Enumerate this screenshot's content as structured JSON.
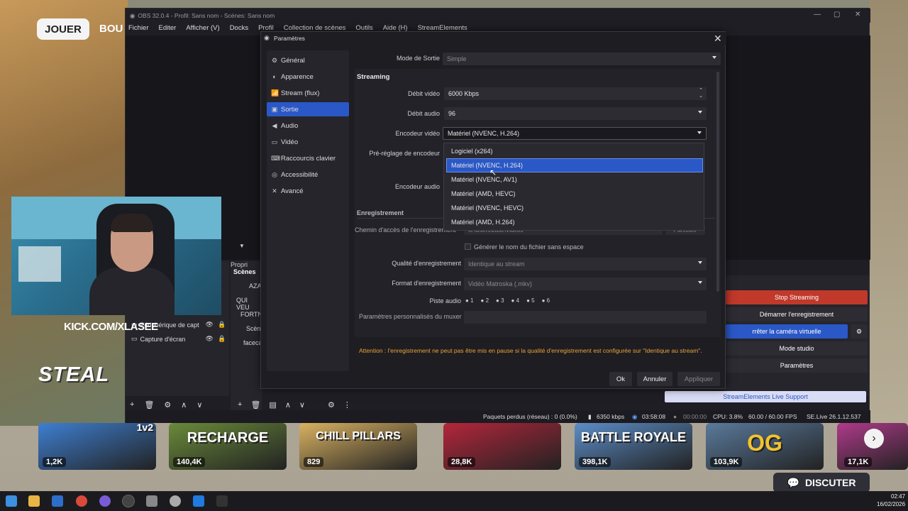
{
  "game": {
    "play_button": "JOUER",
    "shop_button": "BOU",
    "steal": "STEAL",
    "discuter": "DISCUTER",
    "kick": "KICK.COM/XLASEE",
    "tiles": [
      {
        "title": "",
        "count": "1,2K",
        "badge": "1v2",
        "color": "#3e7fd1"
      },
      {
        "title": "RECHARGE",
        "count": "140,4K",
        "color": "#6a8a3a"
      },
      {
        "title": "CHILL PILLARS",
        "count": "829",
        "color": "#d9b262"
      },
      {
        "title": "",
        "count": "28,8K",
        "color": "#b3263b"
      },
      {
        "title": "BATTLE ROYALE",
        "count": "398,1K",
        "color": "#5c8dc7"
      },
      {
        "title": "OG",
        "count": "103,9K",
        "color": "#5a7a9c"
      },
      {
        "title": "",
        "count": "17,1K",
        "color": "#b03a8a"
      }
    ]
  },
  "obs": {
    "title": "OBS 32.0.4 - Profil: Sans nom - Scènes: Sans nom",
    "menu": [
      "Fichier",
      "Editer",
      "Afficher (V)",
      "Docks",
      "Profil",
      "Collection de scènes",
      "Outils",
      "Aide (H)",
      "StreamElements"
    ],
    "docks": {
      "scenes_title": "Scènes",
      "properties_tab": "Propri",
      "scenes": [
        "AZA",
        "QUI VEU",
        "FORTN",
        "Scèn",
        "faceca"
      ],
      "sources": [
        "Périphérique de capt",
        "Capture d'écran"
      ]
    },
    "controls": {
      "stop_streaming": "Stop Streaming",
      "start_recording": "Démarrer l'enregistrement",
      "virtual_cam": "rrêter la caméra virtuelle",
      "studio_mode": "Mode studio",
      "settings": "Paramètres",
      "support": "StreamElements Live Support"
    },
    "status": {
      "dropped": "Paquets perdus (réseau) : 0 (0.0%)",
      "bitrate": "6350 kbps",
      "stream_time": "03:58:08",
      "rec_time": "00:00:00",
      "cpu": "CPU: 3.8%",
      "fps": "60.00 / 60.00 FPS",
      "version": "SE.Live 26.1.12.537"
    }
  },
  "settings": {
    "title": "Paramètres",
    "close": "✕",
    "nav": [
      {
        "label": "Général",
        "icon": "gear-icon",
        "glyph": "⚙"
      },
      {
        "label": "Apparence",
        "icon": "palette-icon",
        "glyph": "◐"
      },
      {
        "label": "Stream (flux)",
        "icon": "antenna-icon",
        "glyph": "📶"
      },
      {
        "label": "Sortie",
        "icon": "output-icon",
        "glyph": "▣",
        "active": true
      },
      {
        "label": "Audio",
        "icon": "speaker-icon",
        "glyph": "◀"
      },
      {
        "label": "Vidéo",
        "icon": "monitor-icon",
        "glyph": "▭"
      },
      {
        "label": "Raccourcis clavier",
        "icon": "keyboard-icon",
        "glyph": "⌨"
      },
      {
        "label": "Accessibilité",
        "icon": "accessibility-icon",
        "glyph": "◎"
      },
      {
        "label": "Avancé",
        "icon": "wrench-icon",
        "glyph": "✕"
      }
    ],
    "output_mode_label": "Mode de Sortie",
    "output_mode_value": "Simple",
    "streaming": {
      "section": "Streaming",
      "video_bitrate_label": "Débit vidéo",
      "video_bitrate_value": "6000 Kbps",
      "audio_bitrate_label": "Débit audio",
      "audio_bitrate_value": "96",
      "video_encoder_label": "Encodeur vidéo",
      "video_encoder_value": "Matériel (NVENC, H.264)",
      "preset_label": "Pré-réglage de encodeur",
      "audio_encoder_label": "Encodeur audio"
    },
    "encoder_options": [
      "Logiciel (x264)",
      "Matériel (NVENC, H.264)",
      "Matériel (NVENC, AV1)",
      "Matériel (AMD, HEVC)",
      "Matériel (NVENC, HEVC)",
      "Matériel (AMD, H.264)"
    ],
    "encoder_selected_index": 1,
    "recording": {
      "section": "Enregistrement",
      "path_label": "Chemin d'accès de l'enregistrement",
      "path_value": "C:\\Users\\Lase\\Videos",
      "browse": "Parcourir",
      "no_space_label": "Générer le nom du fichier sans espace",
      "quality_label": "Qualité d'enregistrement",
      "quality_value": "Identique au stream",
      "format_label": "Format d'enregistrement",
      "format_value": "Vidéo Matroska (.mkv)",
      "audio_track_label": "Piste audio",
      "tracks": [
        "1",
        "2",
        "3",
        "4",
        "5",
        "6"
      ],
      "muxer_label": "Paramètres personnalisés du muxer"
    },
    "warning": "Attention : l'enregistrement ne peut pas être mis en pause si la qualité d'enregistrement est configurée sur \"Identique au stream\".",
    "buttons": {
      "ok": "Ok",
      "cancel": "Annuler",
      "apply": "Appliquer"
    }
  },
  "taskbar": {
    "time": "02:47",
    "date": "16/02/2026"
  }
}
